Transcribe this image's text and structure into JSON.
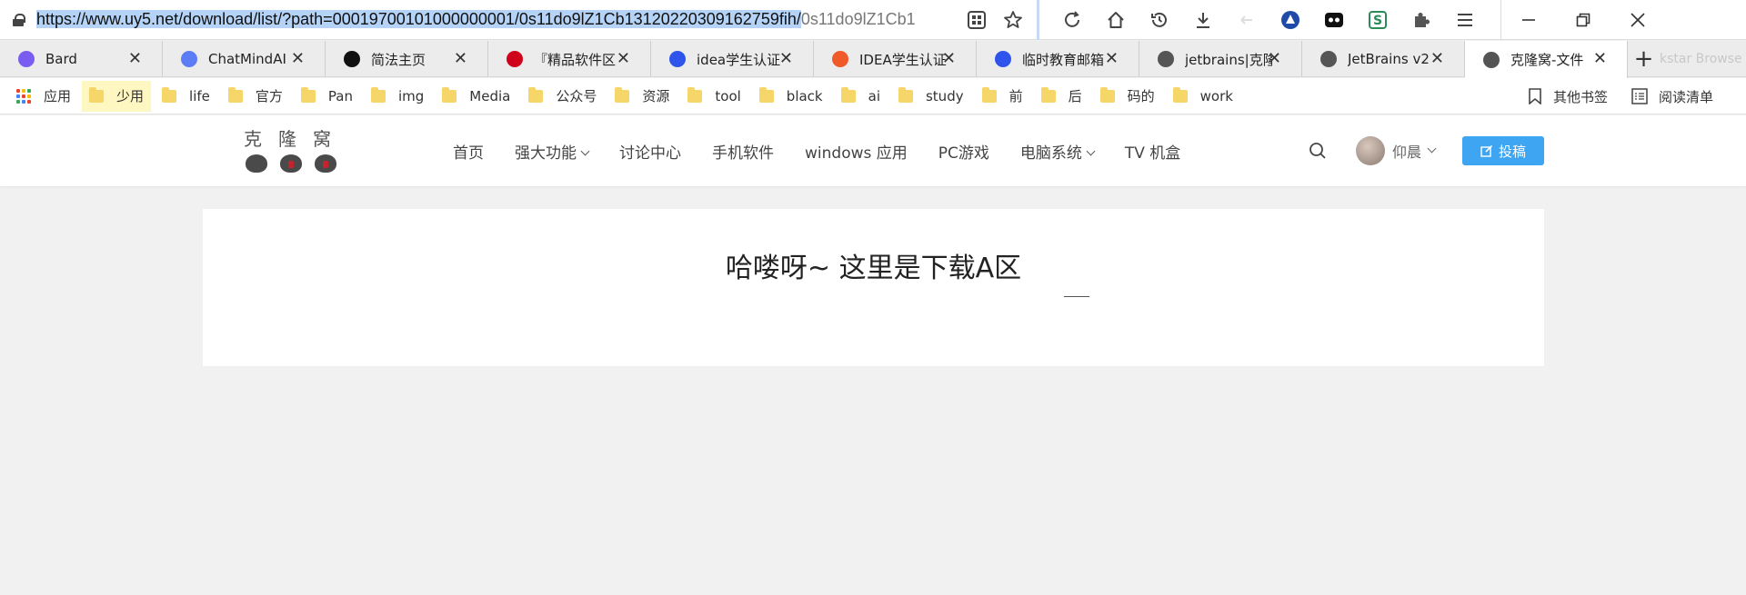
{
  "browser": {
    "url_selected": "https://www.uy5.net/download/list/?path=00019700101000000001/0s11do9lZ1Cb13120220309162759fih/",
    "url_rest": "0s11do9lZ1Cb1",
    "tabs": [
      {
        "title": "Bard",
        "favicon_color": "#7b5cf0",
        "icon": "sparkle-icon"
      },
      {
        "title": "ChatMindAI",
        "favicon_color": "#5b7cf5",
        "icon": "chatmind-icon"
      },
      {
        "title": "简法主页",
        "favicon_color": "#111111",
        "icon": "jianfa-icon"
      },
      {
        "title": "『精品软件区",
        "favicon_color": "#d0021b",
        "icon": "app-icon"
      },
      {
        "title": "idea学生认证",
        "favicon_color": "#2f54eb",
        "icon": "baidu-paw-icon"
      },
      {
        "title": "IDEA学生认证",
        "favicon_color": "#f05a28",
        "icon": "csdn-icon"
      },
      {
        "title": "临时教育邮箱",
        "favicon_color": "#2f54eb",
        "icon": "baidu-paw-icon"
      },
      {
        "title": "jetbrains|克隆",
        "favicon_color": "#555555",
        "icon": "bug-icon"
      },
      {
        "title": "JetBrains v2",
        "favicon_color": "#555555",
        "icon": "bug-icon"
      },
      {
        "title": "克隆窝-文件",
        "favicon_color": "#555555",
        "icon": "bug-icon",
        "active": true
      }
    ],
    "tab_overflow_text": "kstar Browser"
  },
  "bookmarks": {
    "apps_label": "应用",
    "items": [
      "少用",
      "life",
      "官方",
      "Pan",
      "img",
      "Media",
      "公众号",
      "资源",
      "tool",
      "black",
      "ai",
      "study",
      "前",
      "后",
      "码的",
      "work"
    ],
    "other_bookmarks": "其他书签",
    "reading_list": "阅读清单"
  },
  "site": {
    "logo_chars": [
      "克",
      "隆",
      "窝"
    ],
    "nav": [
      {
        "label": "首页",
        "dropdown": false
      },
      {
        "label": "强大功能",
        "dropdown": true
      },
      {
        "label": "讨论中心",
        "dropdown": false
      },
      {
        "label": "手机软件",
        "dropdown": false
      },
      {
        "label": "windows 应用",
        "dropdown": false
      },
      {
        "label": "PC游戏",
        "dropdown": false
      },
      {
        "label": "电脑系统",
        "dropdown": true
      },
      {
        "label": "TV 机盒",
        "dropdown": false
      }
    ],
    "username": "仰晨",
    "post_button": "投稿",
    "accent_color": "#3ea5f2"
  },
  "main": {
    "heading": "哈喽呀~ 这里是下载A区"
  }
}
